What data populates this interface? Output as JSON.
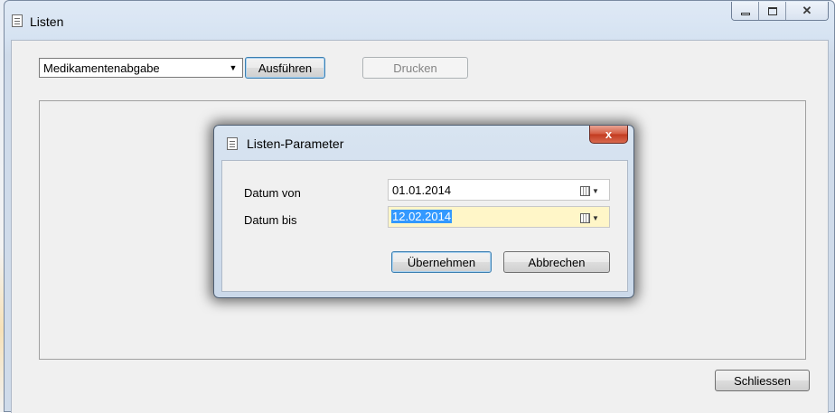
{
  "window": {
    "title": "Listen",
    "icon": "list-window-icon",
    "controls": {
      "minimize": "minimize-icon",
      "maximize": "maximize-icon",
      "close": "close-icon"
    }
  },
  "toolbar": {
    "report_select": {
      "value": "Medikamentenabgabe"
    },
    "execute_label": "Ausführen",
    "print_label": "Drucken"
  },
  "footer": {
    "close_label": "Schliessen"
  },
  "dialog": {
    "title": "Listen-Parameter",
    "close_glyph": "x",
    "fields": [
      {
        "label": "Datum von",
        "value": "01.01.2014"
      },
      {
        "label": "Datum bis",
        "value": "12.02.2014"
      }
    ],
    "apply_label": "Übernehmen",
    "cancel_label": "Abbrechen"
  },
  "colors": {
    "active_field_bg": "#fff6c8",
    "selection": "#3399ff",
    "close_button": "#c23a1f"
  }
}
